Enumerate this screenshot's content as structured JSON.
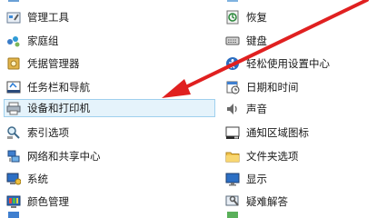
{
  "left_column": [
    {
      "label": "管理工具",
      "icon": "admin-tools-icon"
    },
    {
      "label": "家庭组",
      "icon": "homegroup-icon"
    },
    {
      "label": "凭据管理器",
      "icon": "credential-manager-icon"
    },
    {
      "label": "任务栏和导航",
      "icon": "taskbar-icon"
    },
    {
      "label": "设备和打印机",
      "icon": "devices-printers-icon",
      "selected": true
    },
    {
      "label": "索引选项",
      "icon": "indexing-icon"
    },
    {
      "label": "网络和共享中心",
      "icon": "network-icon"
    },
    {
      "label": "系统",
      "icon": "system-icon"
    },
    {
      "label": "颜色管理",
      "icon": "color-management-icon"
    }
  ],
  "right_column": [
    {
      "label": "恢复",
      "icon": "recovery-icon"
    },
    {
      "label": "键盘",
      "icon": "keyboard-icon"
    },
    {
      "label": "轻松使用设置中心",
      "icon": "ease-of-access-icon"
    },
    {
      "label": "日期和时间",
      "icon": "date-time-icon"
    },
    {
      "label": "声音",
      "icon": "sound-icon"
    },
    {
      "label": "通知区域图标",
      "icon": "notification-area-icon"
    },
    {
      "label": "文件夹选项",
      "icon": "folder-options-icon"
    },
    {
      "label": "显示",
      "icon": "display-icon"
    },
    {
      "label": "疑难解答",
      "icon": "troubleshooting-icon"
    }
  ],
  "colors": {
    "selection_bg": "#e5f3fb",
    "selection_border": "#9fd0ee",
    "arrow": "#e02020"
  }
}
